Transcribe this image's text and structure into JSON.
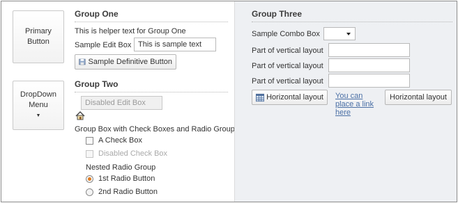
{
  "left_buttons": {
    "primary": {
      "line1": "Primary",
      "line2": "Button"
    },
    "dropdown": {
      "line1": "DropDown",
      "line2": "Menu"
    }
  },
  "group_one": {
    "title": "Group One",
    "helper_text": "This is helper text for Group One",
    "edit_label": "Sample Edit Box",
    "edit_value": "This is sample text",
    "definitive_button": "Sample Definitive Button"
  },
  "group_two": {
    "title": "Group Two",
    "disabled_edit": "Disabled Edit Box",
    "groupbox_label": "Group Box with Check Boxes and Radio Group",
    "checkbox1": "A Check Box",
    "checkbox2": "Disabled Check Box",
    "radio_group_label": "Nested Radio Group",
    "radio1": "1st Radio Button",
    "radio2": "2nd Radio Button",
    "selected_radio": "1st Radio Button"
  },
  "group_three": {
    "title": "Group Three",
    "combo_label": "Sample Combo Box",
    "vertical_labels": [
      "Part of vertical layout",
      "Part of vertical layout",
      "Part of vertical layout"
    ],
    "horizontal_button1": "Horizontal layout",
    "link_lines": [
      "You can",
      "place a link",
      "here"
    ],
    "horizontal_button2": "Horizontal layout"
  },
  "icons": {
    "definitive": "floppy-disk-icon",
    "home": "home-icon",
    "horizontal": "table-icon"
  },
  "colors": {
    "right_panel_bg": "#eef0f3",
    "link": "#4a6fa5",
    "radio_selected": "#e07b1e"
  }
}
